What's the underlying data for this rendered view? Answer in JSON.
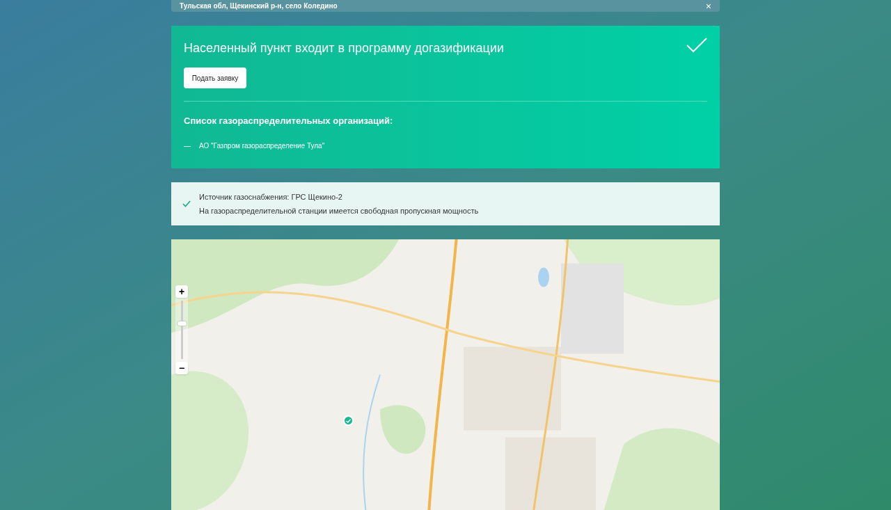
{
  "address_bar": {
    "text": "Тульская обл, Щекинский р-н, село Коледино",
    "close": "×"
  },
  "program_card": {
    "title": "Населенный пункт входит в программу догазификации",
    "button": "Подать заявку",
    "list_title": "Список газораспределительных организаций:",
    "organizations": [
      {
        "dash": "—",
        "name": "АО \"Газпром газораспределение Тула\""
      }
    ]
  },
  "source_box": {
    "lines": [
      "Источник газоснабжения: ГРС Щекино-2",
      "На газораспределительной станции имеется свободная пропускная мощность"
    ]
  },
  "map": {
    "zoom_in": "+",
    "zoom_out": "−",
    "zoom": {
      "level": 0.62
    }
  }
}
